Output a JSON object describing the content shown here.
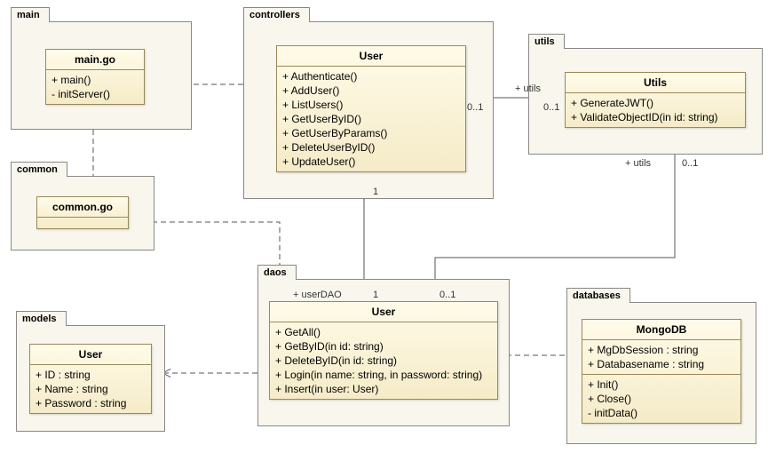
{
  "packages": {
    "main": {
      "label": "main"
    },
    "common": {
      "label": "common"
    },
    "controllers": {
      "label": "controllers"
    },
    "utils": {
      "label": "utils"
    },
    "daos": {
      "label": "daos"
    },
    "models": {
      "label": "models"
    },
    "databases": {
      "label": "databases"
    }
  },
  "classes": {
    "main_go": {
      "title": "main.go",
      "ops": [
        "+ main()",
        "- initServer()"
      ]
    },
    "common_go": {
      "title": "common.go"
    },
    "ctrl_user": {
      "title": "User",
      "ops": [
        "+ Authenticate()",
        "+ AddUser()",
        "+ ListUsers()",
        "+ GetUserByID()",
        "+ GetUserByParams()",
        "+ DeleteUserByID()",
        "+ UpdateUser()"
      ]
    },
    "utils": {
      "title": "Utils",
      "ops": [
        "+ GenerateJWT()",
        "+ ValidateObjectID(in id: string)"
      ]
    },
    "model_user": {
      "title": "User",
      "attrs": [
        "+ ID : string",
        "+ Name : string",
        "+ Password : string"
      ]
    },
    "dao_user": {
      "title": "User",
      "ops": [
        "+ GetAll()",
        "+ GetByID(in id: string)",
        "+ DeleteByID(in id: string)",
        "+ Login(in name: string, in password: string)",
        "+ Insert(in user: User)"
      ]
    },
    "mongodb": {
      "title": "MongoDB",
      "attrs": [
        "+ MgDbSession : string",
        "+ Databasename : string"
      ],
      "ops": [
        "+ Init()",
        "+ Close()",
        "- initData()"
      ]
    }
  },
  "labels": {
    "utils1": "+ utils",
    "m01_a": "0..1",
    "m01_b": "0..1",
    "utils2": "+ utils",
    "m01_c": "0..1",
    "m1_a": "1",
    "m1_b": "1",
    "userDAO": "+ userDAO",
    "m01_d": "0..1"
  },
  "chart_data": {
    "type": "uml-class-diagram",
    "packages": [
      {
        "name": "main",
        "classes": [
          "main.go"
        ]
      },
      {
        "name": "common",
        "classes": [
          "common.go"
        ]
      },
      {
        "name": "controllers",
        "classes": [
          "User"
        ]
      },
      {
        "name": "utils",
        "classes": [
          "Utils"
        ]
      },
      {
        "name": "daos",
        "classes": [
          "User"
        ]
      },
      {
        "name": "models",
        "classes": [
          "User"
        ]
      },
      {
        "name": "databases",
        "classes": [
          "MongoDB"
        ]
      }
    ],
    "classes": [
      {
        "package": "main",
        "name": "main.go",
        "attributes": [],
        "operations": [
          "+ main()",
          "- initServer()"
        ]
      },
      {
        "package": "common",
        "name": "common.go",
        "attributes": [],
        "operations": []
      },
      {
        "package": "controllers",
        "name": "User",
        "attributes": [],
        "operations": [
          "+ Authenticate()",
          "+ AddUser()",
          "+ ListUsers()",
          "+ GetUserByID()",
          "+ GetUserByParams()",
          "+ DeleteUserByID()",
          "+ UpdateUser()"
        ]
      },
      {
        "package": "utils",
        "name": "Utils",
        "attributes": [],
        "operations": [
          "+ GenerateJWT()",
          "+ ValidateObjectID(in id: string)"
        ]
      },
      {
        "package": "models",
        "name": "User",
        "attributes": [
          "+ ID : string",
          "+ Name : string",
          "+ Password : string"
        ],
        "operations": []
      },
      {
        "package": "daos",
        "name": "User",
        "attributes": [],
        "operations": [
          "+ GetAll()",
          "+ GetByID(in id: string)",
          "+ DeleteByID(in id: string)",
          "+ Login(in name: string, in password: string)",
          "+ Insert(in user: User)"
        ]
      },
      {
        "package": "databases",
        "name": "MongoDB",
        "attributes": [
          "+ MgDbSession : string",
          "+ Databasename : string"
        ],
        "operations": [
          "+ Init()",
          "+ Close()",
          "- initData()"
        ]
      }
    ],
    "relations": [
      {
        "from": "main.main.go",
        "to": "controllers.User",
        "type": "dependency"
      },
      {
        "from": "main.main.go",
        "to": "daos.User",
        "type": "dependency"
      },
      {
        "from": "controllers.User",
        "to": "utils.Utils",
        "type": "association",
        "role": "+ utils",
        "from_mult": "0..1",
        "to_mult": "0..1"
      },
      {
        "from": "controllers.User",
        "to": "daos.User",
        "type": "composition",
        "role": "+ userDAO",
        "from_mult": "1",
        "to_mult": "1"
      },
      {
        "from": "daos.User",
        "to": "utils.Utils",
        "type": "association",
        "role": "+ utils",
        "from_mult": "0..1",
        "to_mult": "0..1"
      },
      {
        "from": "daos.User",
        "to": "models.User",
        "type": "dependency"
      },
      {
        "from": "daos.User",
        "to": "databases.MongoDB",
        "type": "dependency"
      }
    ]
  }
}
